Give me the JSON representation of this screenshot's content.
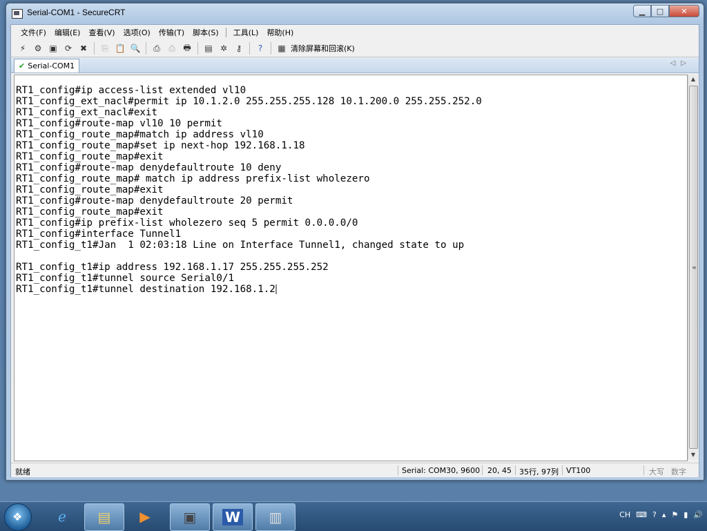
{
  "window": {
    "title": "Serial-COM1 - SecureCRT"
  },
  "menu": {
    "items": [
      "文件(F)",
      "编辑(E)",
      "查看(V)",
      "选项(O)",
      "传输(T)",
      "脚本(S)",
      "工具(L)",
      "帮助(H)"
    ]
  },
  "toolbar": {
    "clear_label": "清除屏幕和回滚(K)"
  },
  "tab": {
    "label": "Serial-COM1"
  },
  "terminal": {
    "lines": [
      "RT1_config#ip access-list extended vl10",
      "RT1_config_ext_nacl#permit ip 10.1.2.0 255.255.255.128 10.1.200.0 255.255.252.0",
      "RT1_config_ext_nacl#exit",
      "RT1_config#route-map vl10 10 permit",
      "RT1_config_route_map#match ip address vl10",
      "RT1_config_route_map#set ip next-hop 192.168.1.18",
      "RT1_config_route_map#exit",
      "RT1_config#route-map denydefaultroute 10 deny",
      "RT1_config_route_map# match ip address prefix-list wholezero",
      "RT1_config_route_map#exit",
      "RT1_config#route-map denydefaultroute 20 permit",
      "RT1_config_route_map#exit",
      "RT1_config#ip prefix-list wholezero seq 5 permit 0.0.0.0/0",
      "RT1_config#interface Tunnel1",
      "RT1_config_t1#Jan  1 02:03:18 Line on Interface Tunnel1, changed state to up",
      "",
      "RT1_config_t1#ip address 192.168.1.17 255.255.255.252",
      "RT1_config_t1#tunnel source Serial0/1",
      "RT1_config_t1#tunnel destination 192.168.1.2"
    ]
  },
  "status": {
    "ready": "就绪",
    "serial": "Serial: COM30, 9600",
    "cursor_pos": "20,  45",
    "size": "35行, 97列",
    "emulation": "VT100",
    "caps": "大写",
    "num": "数字"
  },
  "tray": {
    "lang": "CH"
  }
}
